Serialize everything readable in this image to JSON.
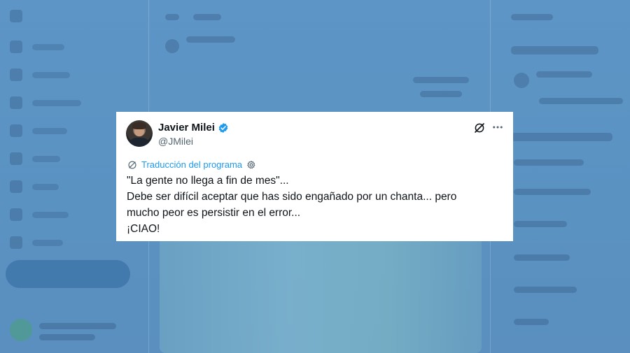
{
  "tweet": {
    "author_name": "Javier Milei",
    "handle": "@JMilei",
    "verified": true,
    "translation_label": "Traducción del programa",
    "text_lines": [
      "\"La gente no llega a fin de mes\"...",
      "Debe ser difícil aceptar que has sido engañado por un chanta... pero",
      "mucho peor es persistir en el error...",
      "¡CIAO!"
    ]
  },
  "icons": {
    "verified": "verified-badge-icon",
    "grok": "grok-icon",
    "more": "more-options-icon",
    "translate": "translate-icon",
    "settings": "gear-icon"
  },
  "colors": {
    "background_overlay": "#5b93c3",
    "accent": "#1d9bf0",
    "text": "#0f1419",
    "muted": "#536471"
  }
}
